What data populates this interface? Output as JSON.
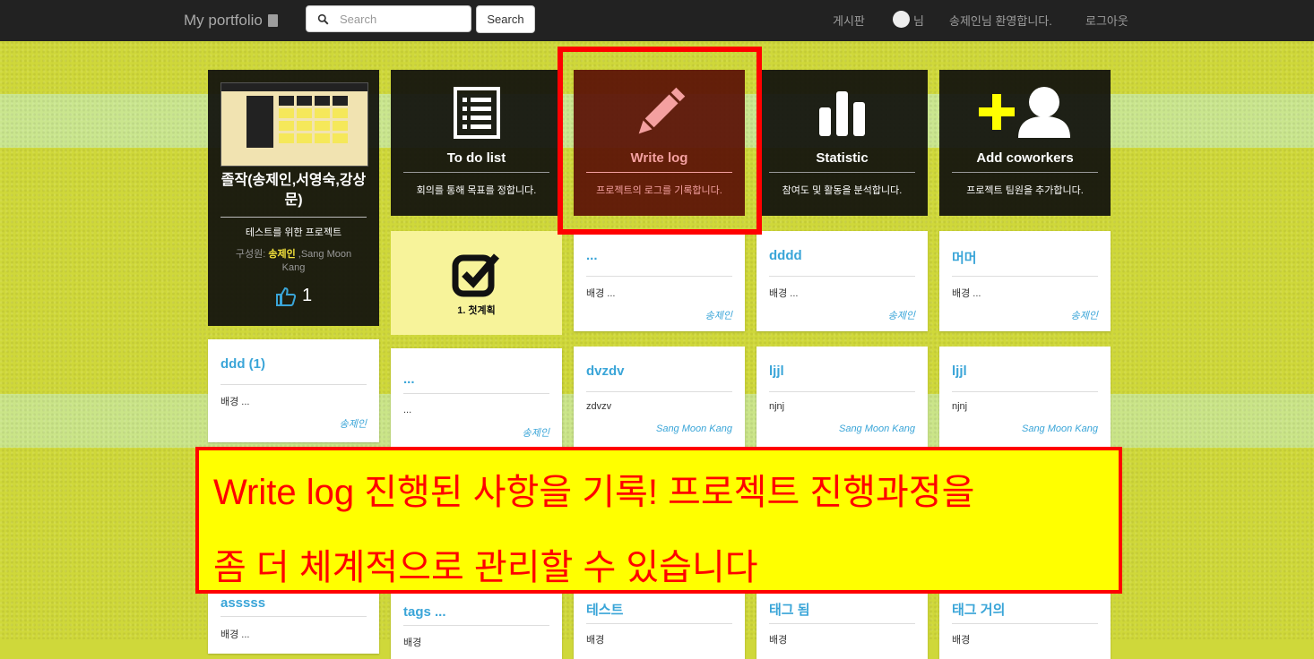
{
  "navbar": {
    "brand": "My portfolio",
    "search_placeholder": "Search",
    "search_button": "Search",
    "board_link": "게시판",
    "user_suffix": "님",
    "welcome": "송제인님 환영합니다.",
    "logout": "로그아웃"
  },
  "project": {
    "title": "졸작(송제인,서영숙,강상문)",
    "description": "테스트를 위한 프로젝트",
    "members_label": "구성원: ",
    "member_highlight": "송제인",
    "members_rest": " ,Sang Moon Kang",
    "like_count": "1"
  },
  "menu": [
    {
      "icon": "list-icon",
      "title": "To do list",
      "desc": "회의를 통해 목표를 정합니다."
    },
    {
      "icon": "pencil-icon",
      "title": "Write log",
      "desc": "프로젝트의 로그를 기록합니다."
    },
    {
      "icon": "bar-chart-icon",
      "title": "Statistic",
      "desc": "참여도 및 활동을 분석합니다."
    },
    {
      "icon": "add-user-icon",
      "title": "Add coworkers",
      "desc": "프로젝트 팀원을 추가합니다."
    }
  ],
  "plan_card": {
    "icon": "checkbox-icon",
    "label": "1. 첫계획"
  },
  "cards": [
    {
      "title": "...",
      "body": "배경 ...",
      "author": "송제인"
    },
    {
      "title": "dddd",
      "body": "배경 ...",
      "author": "송제인"
    },
    {
      "title": "머머",
      "body": "배경 ...",
      "author": "송제인"
    },
    {
      "title": "ddd (1)",
      "body": "배경 ...",
      "author": "송제인"
    },
    {
      "title": "...",
      "body": "...",
      "author": "송제인"
    },
    {
      "title": "dvzdv",
      "body": "zdvzv",
      "author": "Sang Moon Kang"
    },
    {
      "title": "ljjl",
      "body": "njnj",
      "author": "Sang Moon Kang"
    },
    {
      "title": "ljjl",
      "body": "njnj",
      "author": "Sang Moon Kang"
    },
    {
      "title": "asssss",
      "body": "배경 ...",
      "author": ""
    },
    {
      "title": "tags ...",
      "body": "배경",
      "author": ""
    },
    {
      "title": "테스트",
      "body": "배경",
      "author": ""
    },
    {
      "title": "태그 됨",
      "body": "배경",
      "author": ""
    },
    {
      "title": "태그 거의",
      "body": "배경",
      "author": ""
    }
  ],
  "callout": {
    "line1": "Write log 진행된 사항을 기록! 프로젝트 진행과정을",
    "line2": "좀 더 체계적으로 관리할 수 있습니다"
  },
  "colors": {
    "background": "#cfd83a",
    "navbar": "#222222",
    "card_title": "#3aa5d8",
    "highlight": "#ff0000",
    "callout_bg": "#ffff00"
  }
}
